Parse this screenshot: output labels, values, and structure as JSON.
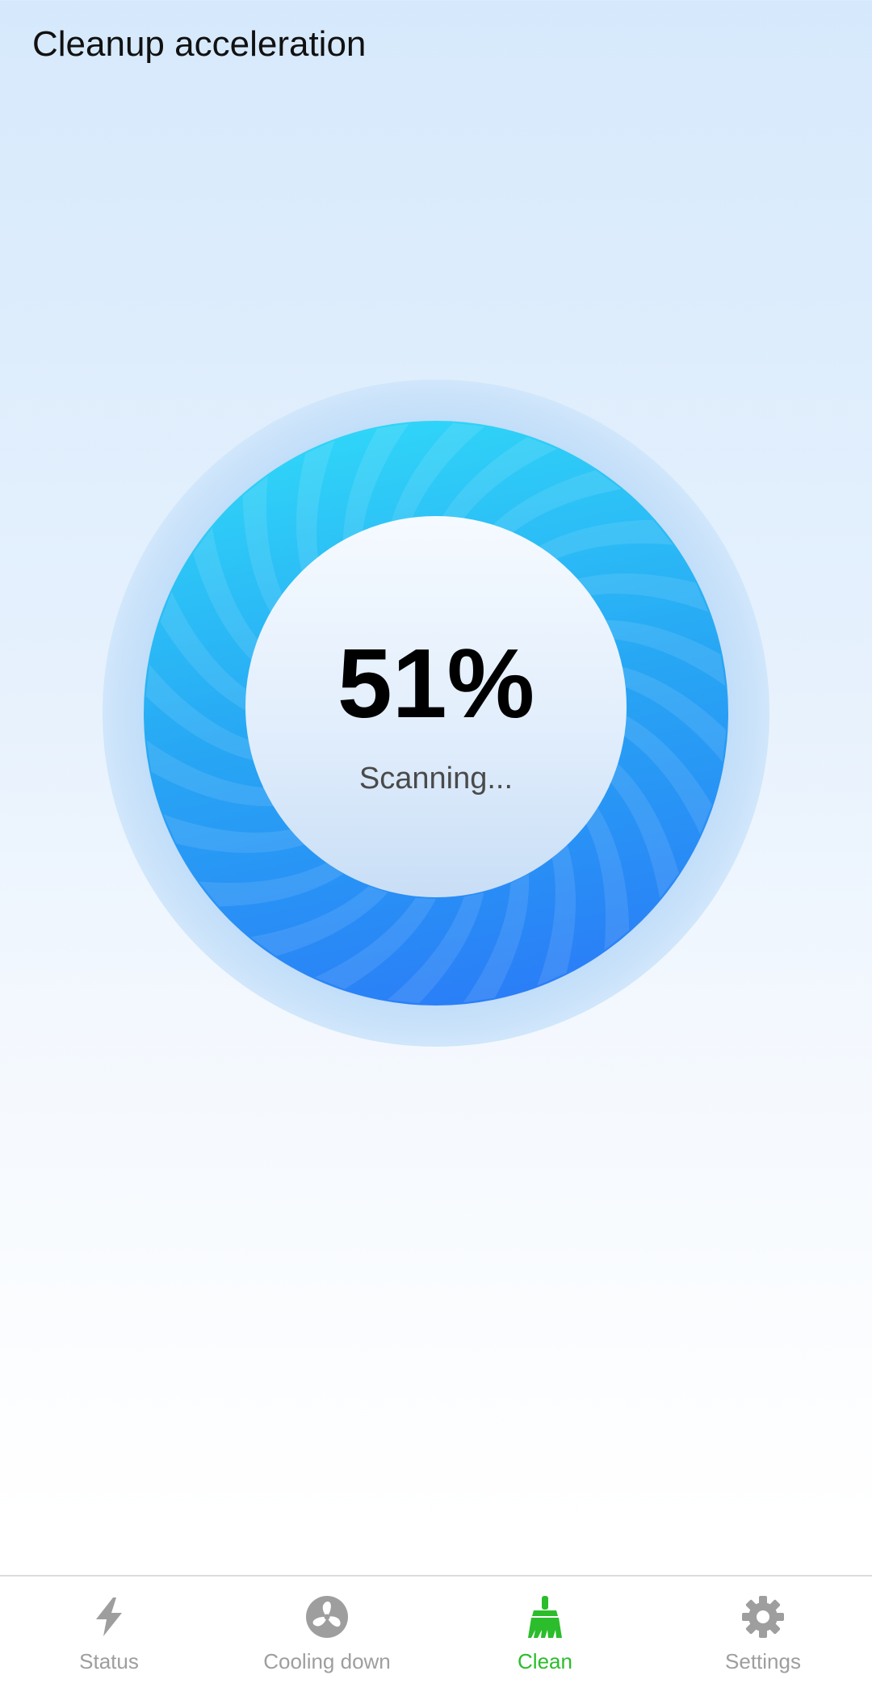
{
  "header": {
    "title": "Cleanup acceleration"
  },
  "scanner": {
    "progress_percent": 51,
    "percent_text": "51%",
    "status_text": "Scanning..."
  },
  "nav": {
    "items": [
      {
        "label": "Status",
        "icon": "bolt-icon",
        "active": false
      },
      {
        "label": "Cooling down",
        "icon": "fan-icon",
        "active": false
      },
      {
        "label": "Clean",
        "icon": "broom-icon",
        "active": true
      },
      {
        "label": "Settings",
        "icon": "gear-icon",
        "active": false
      }
    ]
  },
  "colors": {
    "accent_active": "#2bbd2b",
    "inactive": "#9e9e9e",
    "ring_light": "#30d6f8",
    "ring_dark": "#2a7ef7",
    "halo": "#c4e1fa"
  }
}
